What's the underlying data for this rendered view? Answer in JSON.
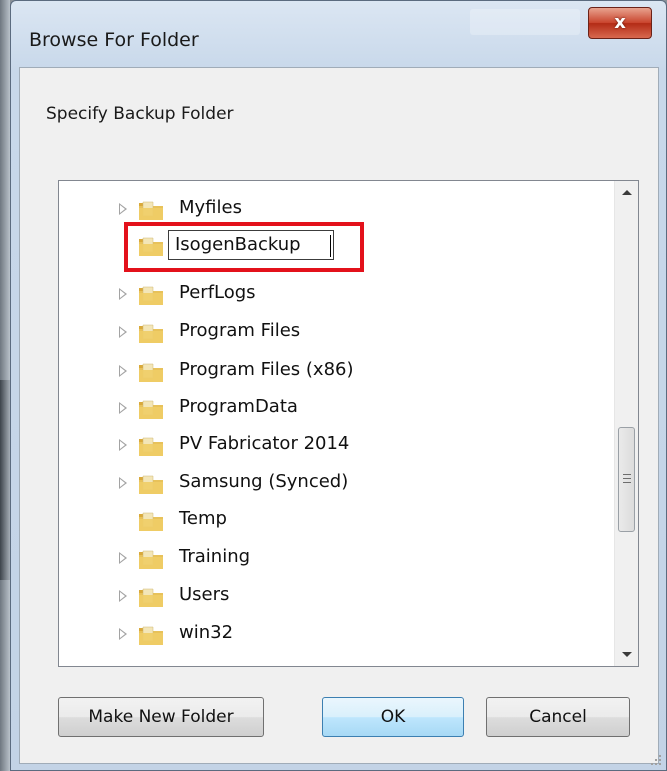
{
  "window": {
    "title": "Browse For Folder",
    "close_label": "x"
  },
  "instructions": "Specify Backup Folder",
  "tree": {
    "items": [
      {
        "label": "Myfiles",
        "expandable": true
      },
      {
        "label": "IsogenBackup",
        "expandable": false,
        "editing": true
      },
      {
        "label": "PerfLogs",
        "expandable": true
      },
      {
        "label": "Program Files",
        "expandable": true
      },
      {
        "label": "Program Files (x86)",
        "expandable": true
      },
      {
        "label": "ProgramData",
        "expandable": true
      },
      {
        "label": "PV Fabricator 2014",
        "expandable": true
      },
      {
        "label": "Samsung (Synced)",
        "expandable": true
      },
      {
        "label": "Temp",
        "expandable": false
      },
      {
        "label": "Training",
        "expandable": true
      },
      {
        "label": "Users",
        "expandable": true
      },
      {
        "label": "win32",
        "expandable": true
      }
    ]
  },
  "buttons": {
    "make_new_folder": "Make New Folder",
    "ok": "OK",
    "cancel": "Cancel"
  },
  "colors": {
    "highlight": "#e3111b",
    "close_button": "#c9432c",
    "folder": "#e8c25a"
  }
}
